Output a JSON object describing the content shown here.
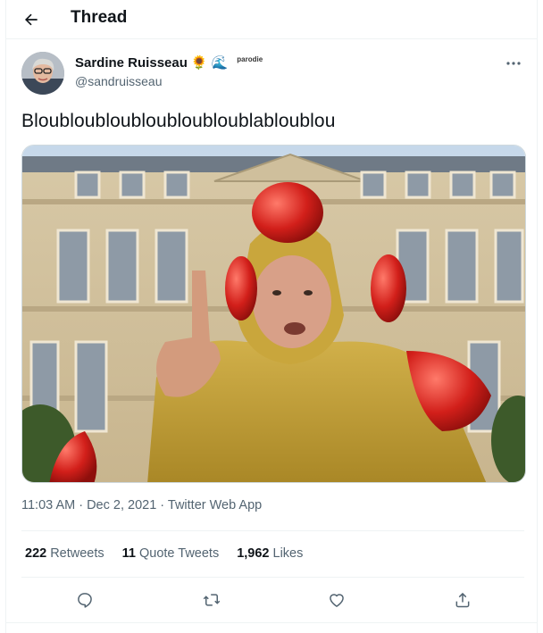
{
  "header": {
    "title": "Thread",
    "back_icon": "arrow-left-icon"
  },
  "tweet": {
    "author_name": "Sardine Ruisseau",
    "badges": [
      "🌻",
      "🌊"
    ],
    "badge_text": "parodie",
    "handle": "@sandruisseau",
    "text": "Bloubloubloubloubloubloublabloublou",
    "timestamp": "11:03 AM · Dec 2, 2021 · Twitter Web App",
    "stats": {
      "retweets_count": "222",
      "retweets_label": "Retweets",
      "quotes_count": "11",
      "quotes_label": "Quote Tweets",
      "likes_count": "1,962",
      "likes_label": "Likes"
    }
  },
  "icons": {
    "more": "more-horizontal-icon",
    "reply": "reply-icon",
    "retweet": "retweet-icon",
    "like": "heart-icon",
    "share": "share-icon"
  },
  "colors": {
    "text": "#0f1419",
    "muted": "#536471",
    "border": "#eff3f4"
  }
}
